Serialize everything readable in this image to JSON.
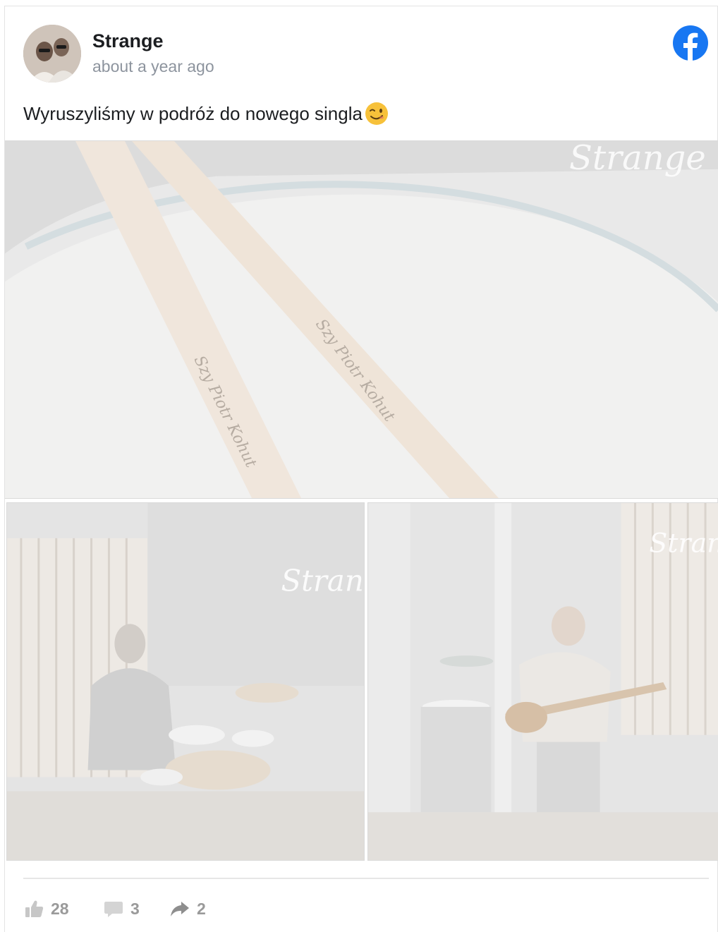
{
  "post": {
    "author": "Strange",
    "timestamp": "about a year ago",
    "text": "Wyruszyliśmy w podróż do nowego singla",
    "emoji": "winking-face-icon",
    "platform_icon": "facebook-icon"
  },
  "photos": [
    {
      "overlay_text": "Strange",
      "engraving": "Szy Piotr Kohut"
    },
    {
      "overlay_text": "Strange"
    },
    {
      "overlay_text": "Strange"
    }
  ],
  "stats": {
    "likes": "28",
    "comments": "3",
    "shares": "2"
  },
  "colors": {
    "facebook_blue": "#1877f2",
    "text_primary": "#1c1e21",
    "text_muted": "#8d949e",
    "stat_gray": "#9a9a9a"
  }
}
